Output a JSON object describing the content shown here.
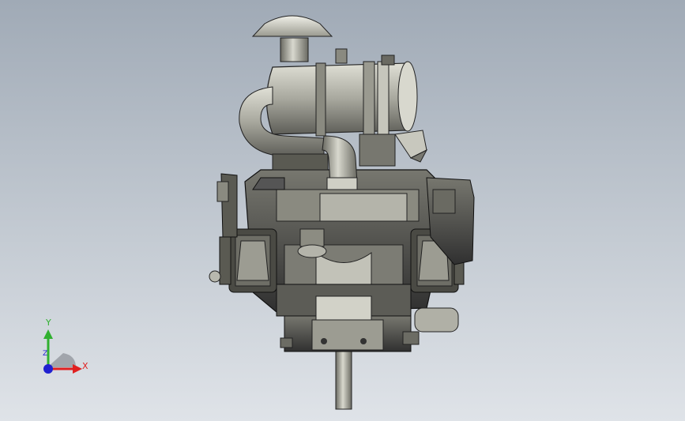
{
  "viewport": {
    "background_top": "#a0aab6",
    "background_bottom": "#dfe3e8"
  },
  "model": {
    "description_icon": "engine-assembly-icon",
    "body_color": "#8e8e84",
    "highlight_color": "#d6d6cc",
    "shadow_color": "#3a3a36",
    "edge_color": "#1a1a1a"
  },
  "triad": {
    "x_label": "X",
    "y_label": "Y",
    "z_label": "Z",
    "x_color": "#e02020",
    "y_color": "#30b030",
    "z_color": "#2020d0"
  }
}
